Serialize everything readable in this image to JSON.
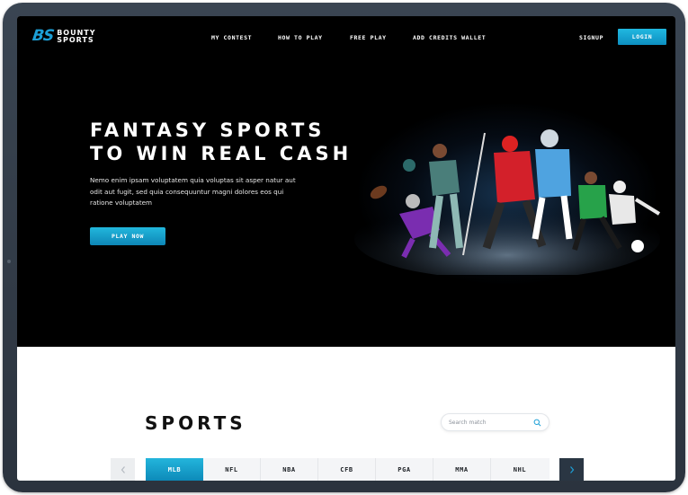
{
  "brand": {
    "logo_mark": "BS",
    "logo_line1": "BOUNTY",
    "logo_line2": "SPORTS"
  },
  "nav": {
    "items": [
      {
        "label": "MY CONTEST"
      },
      {
        "label": "HOW TO PLAY"
      },
      {
        "label": "FREE PLAY"
      },
      {
        "label": "ADD CREDITS WALLET"
      }
    ],
    "signup_label": "SIGNUP",
    "login_label": "LOGIN"
  },
  "hero": {
    "title_line1": "FANTASY SPORTS",
    "title_line2": "TO WIN REAL CASH",
    "description": "Nemo enim ipsam voluptatem quia voluptas sit asper natur aut odit aut fugit, sed quia consequuntur magni dolores eos qui ratione voluptatem",
    "cta_label": "PLAY NOW",
    "image_icon": "athletes-collage-image"
  },
  "sports": {
    "title": "SPORTS",
    "search_placeholder": "Search match",
    "tabs": [
      {
        "label": "MLB",
        "active": true
      },
      {
        "label": "NFL",
        "active": false
      },
      {
        "label": "NBA",
        "active": false
      },
      {
        "label": "CFB",
        "active": false
      },
      {
        "label": "PGA",
        "active": false
      },
      {
        "label": "MMA",
        "active": false
      },
      {
        "label": "NHL",
        "active": false
      }
    ]
  },
  "colors": {
    "accent": "#1c9fd6",
    "hero_bg": "#000000",
    "frame": "#2f3843",
    "nav_arrow_dark": "#2a3643"
  }
}
